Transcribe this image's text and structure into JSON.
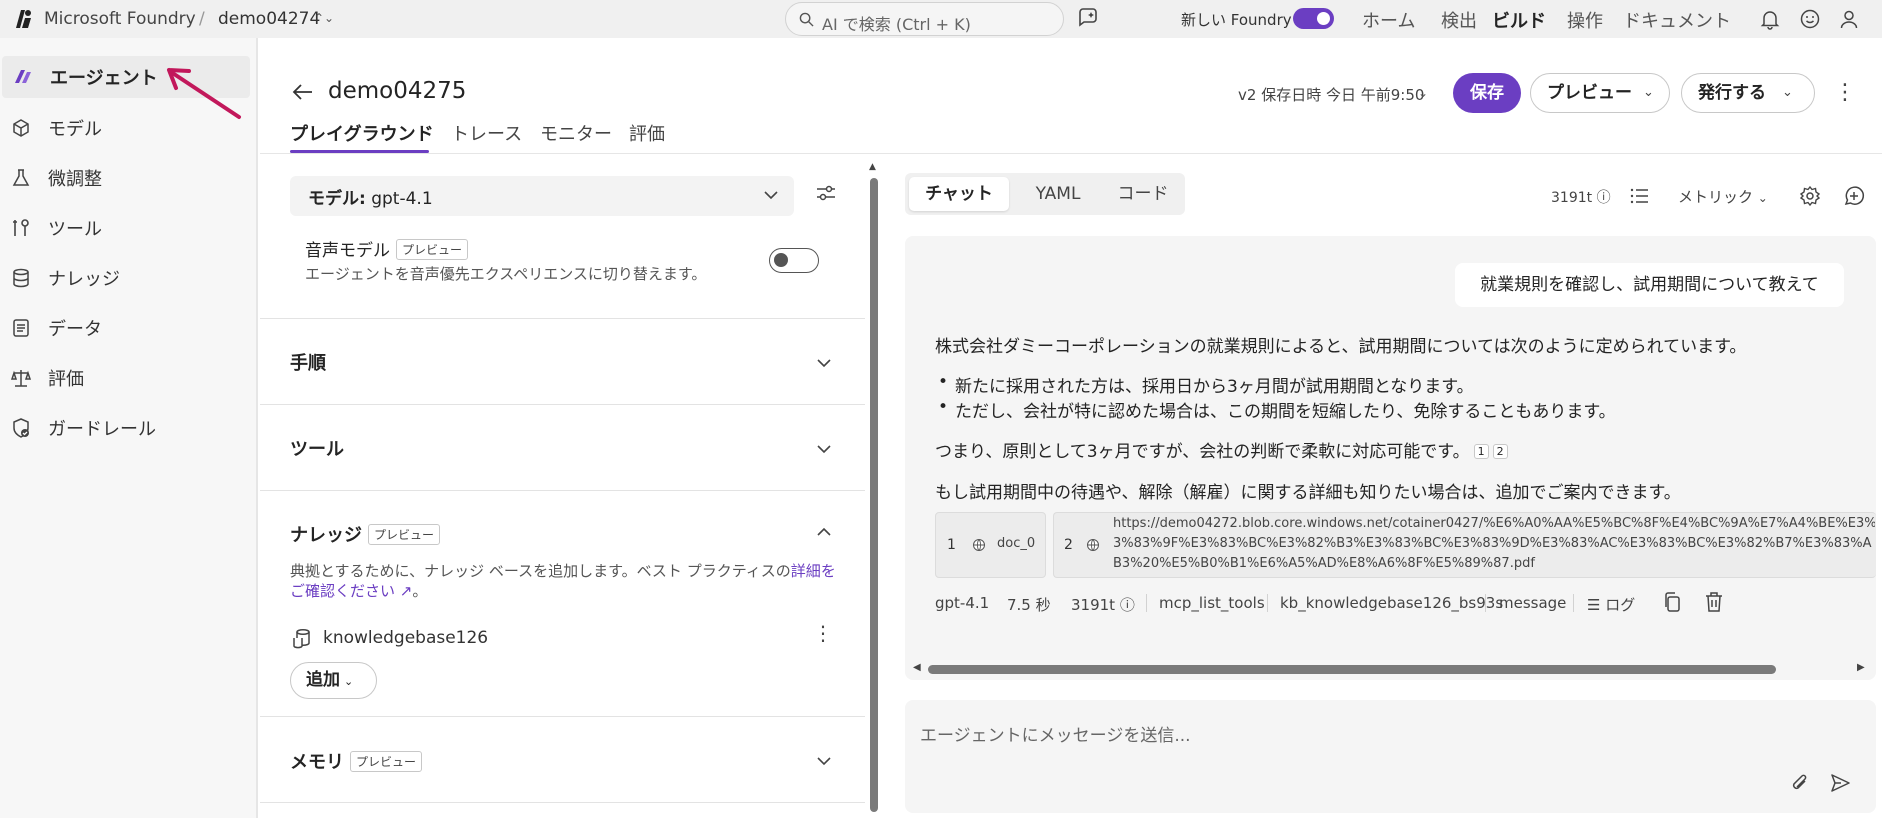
{
  "topbar": {
    "brand": "Microsoft Foundry",
    "separator": "/",
    "project": "demo04274",
    "search_placeholder": "AI で検索 (Ctrl + K)",
    "new_foundry_label": "新しい Foundry",
    "nav": [
      "ホーム",
      "検出",
      "ビルド",
      "操作",
      "ドキュメント"
    ],
    "active_nav": "ビルド"
  },
  "sidebar": {
    "items": [
      {
        "label": "エージェント",
        "icon": "agent-icon",
        "active": true
      },
      {
        "label": "モデル",
        "icon": "model-icon"
      },
      {
        "label": "微調整",
        "icon": "flask-icon"
      },
      {
        "label": "ツール",
        "icon": "tools-icon"
      },
      {
        "label": "ナレッジ",
        "icon": "database-icon"
      },
      {
        "label": "データ",
        "icon": "data-icon"
      },
      {
        "label": "評価",
        "icon": "scale-icon"
      },
      {
        "label": "ガードレール",
        "icon": "shield-icon"
      }
    ]
  },
  "header": {
    "title": "demo04275",
    "tabs": [
      "プレイグラウンド",
      "トレース",
      "モニター",
      "評価"
    ],
    "version": "v2 保存日時 今日 午前9:50",
    "save": "保存",
    "preview": "プレビュー",
    "publish": "発行する"
  },
  "config": {
    "model_label": "モデル:",
    "model_value": "gpt-4.1",
    "voice_title": "音声モデル",
    "preview_badge": "プレビュー",
    "voice_desc": "エージェントを音声優先エクスペリエンスに切り替えます。",
    "voice_enabled": false,
    "sections": {
      "steps": "手順",
      "tools": "ツール",
      "knowledge": "ナレッジ",
      "memory": "メモリ"
    },
    "knowledge_desc": "典拠とするために、ナレッジ ベースを追加します。ベスト プラクティスの",
    "knowledge_link_1": "詳細を",
    "knowledge_link_2": "ご確認ください",
    "knowledge_desc_end": "。",
    "kb_name": "knowledgebase126",
    "add_label": "追加"
  },
  "chat": {
    "tabs": [
      "チャット",
      "YAML",
      "コード"
    ],
    "tokens": "3191t",
    "metric_label": "メトリック",
    "user_message": "就業規則を確認し、試用期間について教えて",
    "response_intro": "株式会社ダミーコーポレーションの就業規則によると、試用期間については次のように定められています。",
    "response_bullets": [
      "新たに採用された方は、採用日から3ヶ月間が試用期間となります。",
      "ただし、会社が特に認めた場合は、この期間を短縮したり、免除することもあります。"
    ],
    "response_summary": "つまり、原則として3ヶ月ですが、会社の判断で柔軟に対応可能です。",
    "citations": [
      "1",
      "2"
    ],
    "response_followup": "もし試用期間中の待遇や、解除（解雇）に関する詳細も知りたい場合は、追加でご案内できます。",
    "sources": [
      {
        "num": "1",
        "text": "doc_0"
      },
      {
        "num": "2",
        "lines": [
          "https://demo04272.blob.core.windows.net/cotainer0427/%E6%A0%AA%E5%BC%8F%E4%BC%9A%E7%A4%BE%E3%",
          "3%83%9F%E3%83%BC%E3%82%B3%E3%83%BC%E3%83%9D%E3%83%AC%E3%83%BC%E3%82%B7%E3%83%A",
          "B3%20%E5%B0%B1%E6%A5%AD%E8%A6%8F%E5%89%87.pdf"
        ]
      }
    ],
    "meta": {
      "model": "gpt-4.1",
      "duration": "7.5 秒",
      "tokens": "3191t",
      "tool1": "mcp_list_tools",
      "tool2": "kb_knowledgebase126_bs93s",
      "type": "message",
      "log": "ログ"
    },
    "input_placeholder": "エージェントにメッセージを送信..."
  },
  "colors": {
    "accent": "#6b3ec2",
    "annotation_arrow": "#c2185b"
  }
}
